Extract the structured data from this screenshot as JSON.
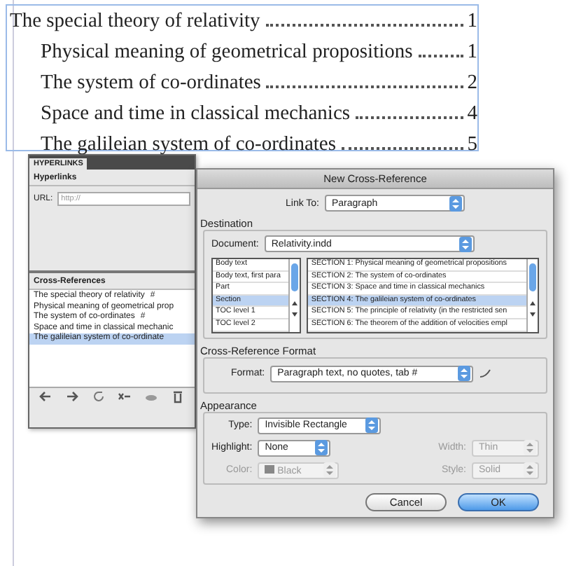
{
  "document": {
    "toc": [
      {
        "title": "The special theory of relativity",
        "page": "1",
        "children": [
          {
            "title": "Physical meaning of geometrical propositions",
            "page": "1"
          },
          {
            "title": "The system of co-ordinates",
            "page": "2"
          },
          {
            "title": "Space and time in classical mechanics",
            "page": "4"
          },
          {
            "title": "The galileian system of co-ordinates",
            "page": "5"
          }
        ]
      }
    ]
  },
  "hyperlinks_panel": {
    "tab": "HYPERLINKS",
    "hyperlinks_heading": "Hyperlinks",
    "url_label": "URL:",
    "url_placeholder": "http://",
    "cross_references_heading": "Cross-References",
    "cross_references": [
      {
        "label": "The special theory of relativity",
        "marker": "#",
        "selected": false
      },
      {
        "label": "Physical meaning of geometrical prop",
        "selected": false
      },
      {
        "label": "The system of co-ordinates",
        "marker": "#",
        "selected": false
      },
      {
        "label": "Space and time in classical mechanic",
        "selected": false
      },
      {
        "label": "The galileian system of co-ordinate",
        "selected": true
      }
    ]
  },
  "dialog": {
    "title": "New Cross-Reference",
    "link_to": {
      "label": "Link To:",
      "value": "Paragraph"
    },
    "destination": {
      "heading": "Destination",
      "document_label": "Document:",
      "document_value": "Relativity.indd",
      "paragraph_styles": [
        {
          "label": "Body text",
          "selected": false
        },
        {
          "label": "Body text, first para",
          "selected": false
        },
        {
          "label": "Part",
          "selected": false
        },
        {
          "label": "Section",
          "selected": true
        },
        {
          "label": "TOC level 1",
          "selected": false
        },
        {
          "label": "TOC level 2",
          "selected": false
        }
      ],
      "paragraphs": [
        {
          "label": "SECTION 1:  Physical meaning of geometrical propositions",
          "selected": false
        },
        {
          "label": "SECTION 2:  The system of co-ordinates",
          "selected": false
        },
        {
          "label": "SECTION 3:  Space and time in classical mechanics",
          "selected": false
        },
        {
          "label": "SECTION 4:  The galileian system of co-ordinates",
          "selected": true
        },
        {
          "label": "SECTION 5:  The principle of relativity (in the restricted sen",
          "selected": false
        },
        {
          "label": "SECTION 6:  The theorem of the addition of velocities empl",
          "selected": false
        }
      ]
    },
    "format_group": {
      "heading": "Cross-Reference Format",
      "label": "Format:",
      "value": "Paragraph text, no quotes, tab #"
    },
    "appearance": {
      "heading": "Appearance",
      "rows": [
        [
          {
            "label": "Type:",
            "value": "Invisible Rectangle",
            "disabled": false,
            "kind": "popup"
          }
        ],
        [
          {
            "label": "Highlight:",
            "value": "None",
            "disabled": false,
            "kind": "popup"
          },
          {
            "label": "Width:",
            "value": "Thin",
            "disabled": true,
            "kind": "popup"
          }
        ],
        [
          {
            "label": "Color:",
            "value": "Black",
            "disabled": true,
            "kind": "swatch"
          },
          {
            "label": "Style:",
            "value": "Solid",
            "disabled": true,
            "kind": "popup"
          }
        ]
      ]
    },
    "buttons": [
      {
        "label": "Cancel",
        "default": false
      },
      {
        "label": "OK",
        "default": true
      }
    ]
  }
}
